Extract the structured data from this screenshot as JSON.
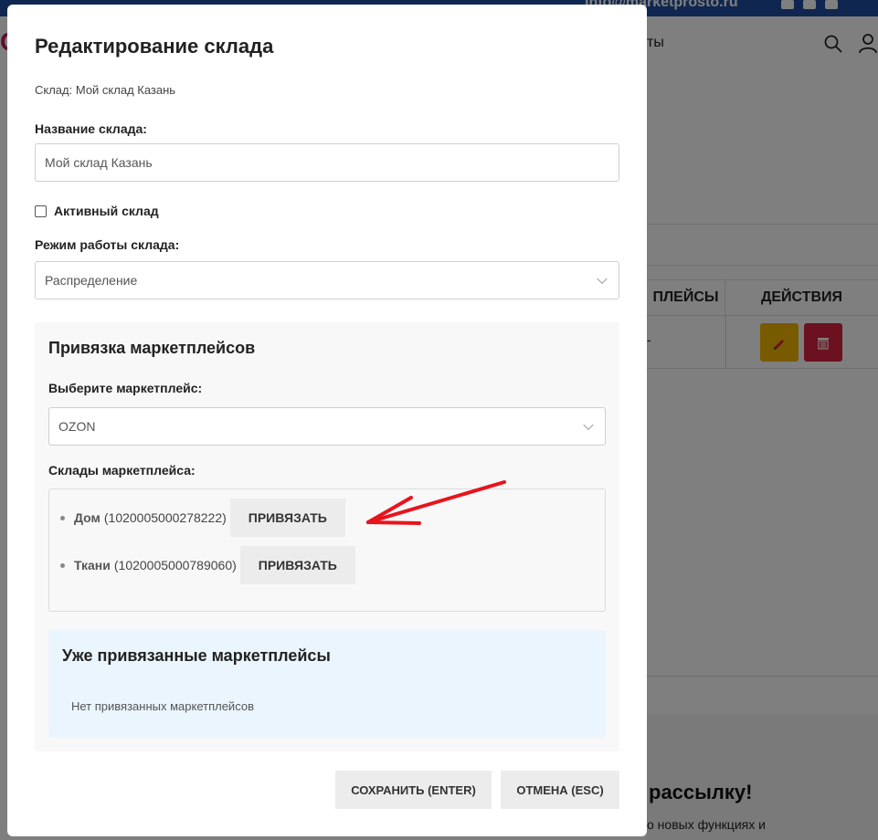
{
  "background": {
    "topbar_email": "info@marketprosto.ru",
    "nav_fragment": "ты",
    "left_fragment": "C",
    "table": {
      "col_marketplaces": "ПЛЕЙСЫ",
      "col_actions": "ДЕЙСТВИЯ",
      "row_dash": "-"
    },
    "newsletter_title": "рассылку!",
    "newsletter_sub": "о новых функциях и"
  },
  "modal": {
    "title": "Редактирование склада",
    "subtitle": "Склад: Мой склад Казань",
    "name_label": "Название склада:",
    "name_value": "Мой склад Казань",
    "active_label": "Активный склад",
    "mode_label": "Режим работы склада:",
    "mode_value": "Распределение",
    "binding": {
      "title": "Привязка маркетплейсов",
      "select_label": "Выберите маркетплейс:",
      "selected_marketplace": "OZON",
      "warehouses_label": "Склады маркетплейса:",
      "warehouses": [
        {
          "name": "Дом",
          "id": "(1020005000278222)",
          "button": "ПРИВЯЗАТЬ"
        },
        {
          "name": "Ткани",
          "id": "(1020005000789060)",
          "button": "ПРИВЯЗАТЬ"
        }
      ]
    },
    "linked": {
      "title": "Уже привязанные маркетплейсы",
      "empty_text": "Нет привязанных маркетплейсов"
    },
    "save_button": "СОХРАНИТЬ (ENTER)",
    "cancel_button": "ОТМЕНА (ESC)"
  },
  "colors": {
    "topbar": "#1e4fa0",
    "edit_button": "#f0b400",
    "delete_button": "#d9223f",
    "arrow": "#e8141c",
    "linked_panel": "#eaf5fd"
  }
}
